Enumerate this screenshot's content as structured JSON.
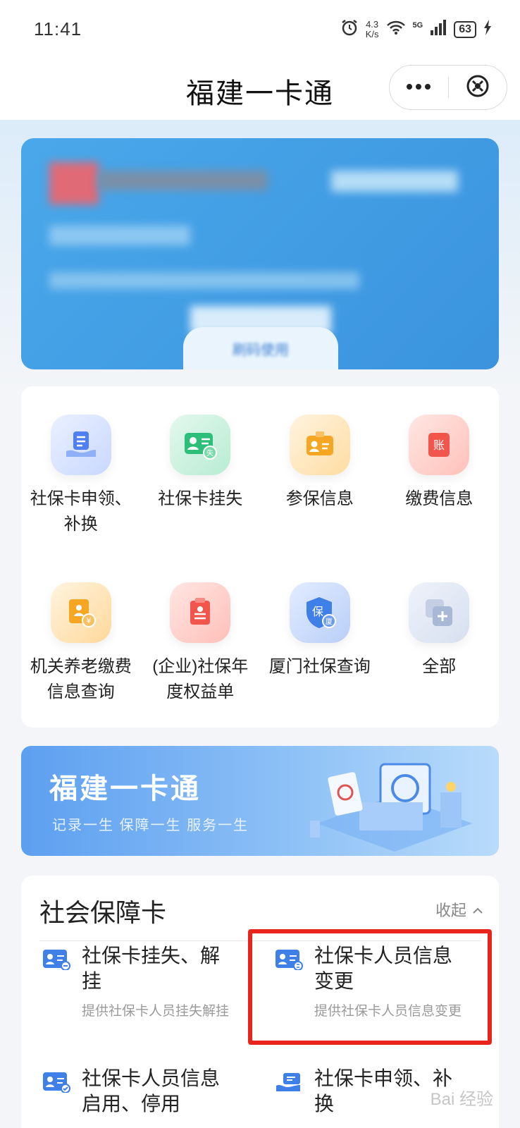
{
  "status_bar": {
    "time": "11:41",
    "speed_value": "4.3",
    "speed_unit": "K/s",
    "network": "5G",
    "battery": "63",
    "icons": [
      "alarm-icon",
      "wifi-icon",
      "signal-icon",
      "charging-icon"
    ]
  },
  "header": {
    "title": "福建一卡通",
    "menu_icon": "more-dots-icon",
    "close_icon": "close-circle-icon"
  },
  "card": {
    "obscured": true,
    "tab_text": "刷码使用"
  },
  "services": [
    {
      "label": "社保卡申领、补换",
      "icon": "card-apply-icon",
      "color": "#4f7ff0"
    },
    {
      "label": "社保卡挂失",
      "icon": "card-loss-icon",
      "color": "#2dbf7a"
    },
    {
      "label": "参保信息",
      "icon": "insured-info-icon",
      "color": "#f5a623"
    },
    {
      "label": "缴费信息",
      "icon": "payment-info-icon",
      "color": "#f2554b"
    },
    {
      "label": "机关养老缴费信息查询",
      "icon": "pension-payment-icon",
      "color": "#f5a623"
    },
    {
      "label": "(企业)社保年度权益单",
      "icon": "annual-statement-icon",
      "color": "#f2554b"
    },
    {
      "label": "厦门社保查询",
      "icon": "xiamen-query-icon",
      "color": "#3f7fe8"
    },
    {
      "label": "全部",
      "icon": "all-services-icon",
      "color": "#a8b8d6"
    }
  ],
  "banner": {
    "title": "福建一卡通",
    "subtitle": "记录一生 保障一生 服务一生"
  },
  "section": {
    "title": "社会保障卡",
    "collapse_label": "收起",
    "items": [
      {
        "title": "社保卡挂失、解挂",
        "desc": "提供社保卡人员挂失解挂",
        "icon": "card-unlock-icon"
      },
      {
        "title": "社保卡人员信息变更",
        "desc": "提供社保卡人员信息变更",
        "icon": "card-info-change-icon"
      },
      {
        "title": "社保卡人员信息启用、停用",
        "desc": "",
        "icon": "card-enable-icon"
      },
      {
        "title": "社保卡申领、补换",
        "desc": "",
        "icon": "card-apply-hand-icon"
      }
    ]
  },
  "watermark": "Bai 经验"
}
